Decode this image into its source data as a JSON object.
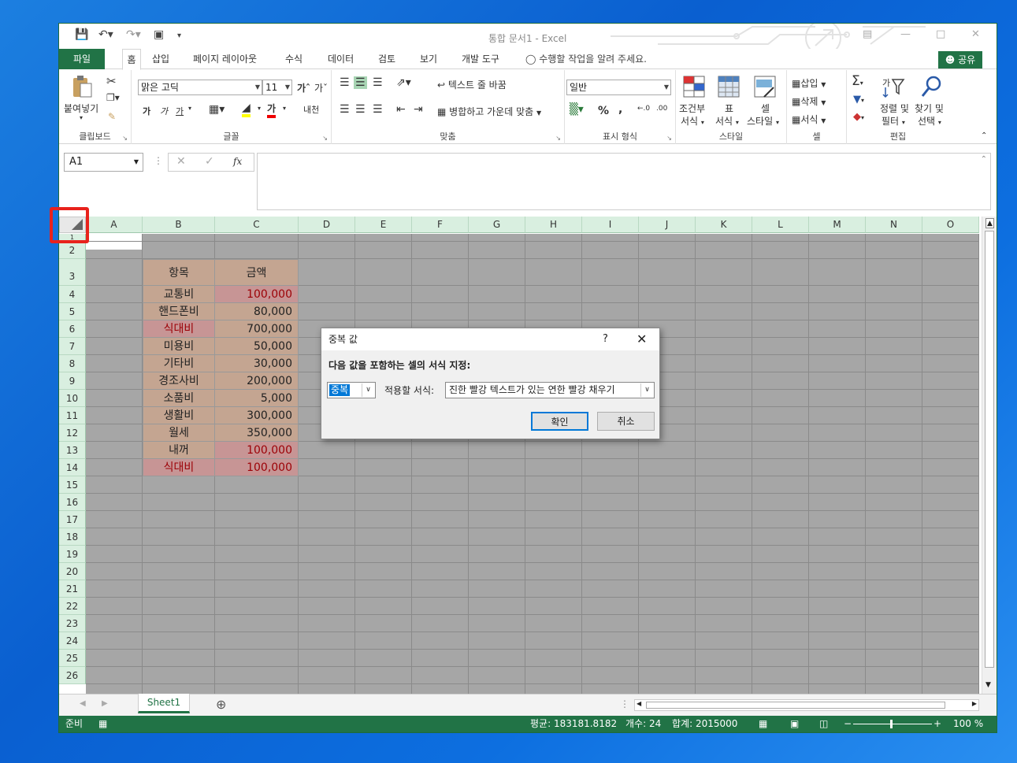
{
  "window": {
    "title": "통합 문서1 - Excel"
  },
  "tabs": [
    "파일",
    "홈",
    "삽입",
    "페이지 레이아웃",
    "수식",
    "데이터",
    "검토",
    "보기",
    "개발 도구"
  ],
  "tellme": "수행할 작업을 알려 주세요.",
  "share": "공유",
  "ribbon": {
    "clipboard": {
      "label": "클립보드",
      "paste": "붙여넣기"
    },
    "font": {
      "label": "글꼴",
      "name": "맑은 고딕",
      "size": "11",
      "bold": "가",
      "italic": "가",
      "underline": "가",
      "color_letter": "가",
      "phonetic": "내천"
    },
    "align": {
      "label": "맞춤",
      "wrap": "텍스트 줄 바꿈",
      "merge": "병합하고 가운데 맞춤"
    },
    "number": {
      "label": "표시 형식",
      "format": "일반",
      "percent": "%",
      "comma": ","
    },
    "styles": {
      "label": "스타일",
      "cond1": "조건부",
      "cond2": "서식",
      "table1": "표",
      "table2": "서식",
      "cell1": "셀",
      "cell2": "스타일"
    },
    "cells": {
      "label": "셀",
      "insert": "삽입",
      "delete": "삭제",
      "format": "서식"
    },
    "edit": {
      "label": "편집",
      "sort1": "정렬 및",
      "sort2": "필터",
      "find1": "찾기 및",
      "find2": "선택"
    }
  },
  "formula": {
    "namebox": "A1",
    "fx": "fx"
  },
  "columns": [
    "A",
    "B",
    "C",
    "D",
    "E",
    "F",
    "G",
    "H",
    "I",
    "J",
    "K",
    "L",
    "M",
    "N",
    "O"
  ],
  "rows": [
    "1",
    "2",
    "3",
    "4",
    "5",
    "6",
    "7",
    "8",
    "9",
    "10",
    "11",
    "12",
    "13",
    "14",
    "15",
    "16",
    "17",
    "18",
    "19",
    "20",
    "21",
    "22",
    "23",
    "24",
    "25",
    "26"
  ],
  "table": {
    "header": [
      "항목",
      "금액"
    ],
    "rows": [
      {
        "item": "교통비",
        "amount": "100,000"
      },
      {
        "item": "핸드폰비",
        "amount": "80,000"
      },
      {
        "item": "식대비",
        "amount": "700,000"
      },
      {
        "item": "미용비",
        "amount": "50,000"
      },
      {
        "item": "기타비",
        "amount": "30,000"
      },
      {
        "item": "경조사비",
        "amount": "200,000"
      },
      {
        "item": "소품비",
        "amount": "5,000"
      },
      {
        "item": "생활비",
        "amount": "300,000"
      },
      {
        "item": "월세",
        "amount": "350,000"
      },
      {
        "item": "내꺼",
        "amount": "100,000"
      },
      {
        "item": "식대비",
        "amount": "100,000"
      }
    ]
  },
  "dialog": {
    "title": "중복 값",
    "help": "?",
    "instruction": "다음 값을 포함하는 셀의 서식 지정:",
    "type": "중복",
    "format_label": "적용할 서식:",
    "format_value": "진한 빨강 텍스트가 있는 연한 빨강 채우기",
    "ok": "확인",
    "cancel": "취소"
  },
  "sheet": {
    "name": "Sheet1"
  },
  "status": {
    "ready": "준비",
    "average": "평균: 183181.8182",
    "count": "개수: 24",
    "sum": "합계: 2015000",
    "zoom": "100 %"
  },
  "colors": {
    "excel_green": "#217346",
    "header_fill": "#c4a591",
    "dup_fill": "#c79595",
    "dup_text": "#9c0006"
  }
}
